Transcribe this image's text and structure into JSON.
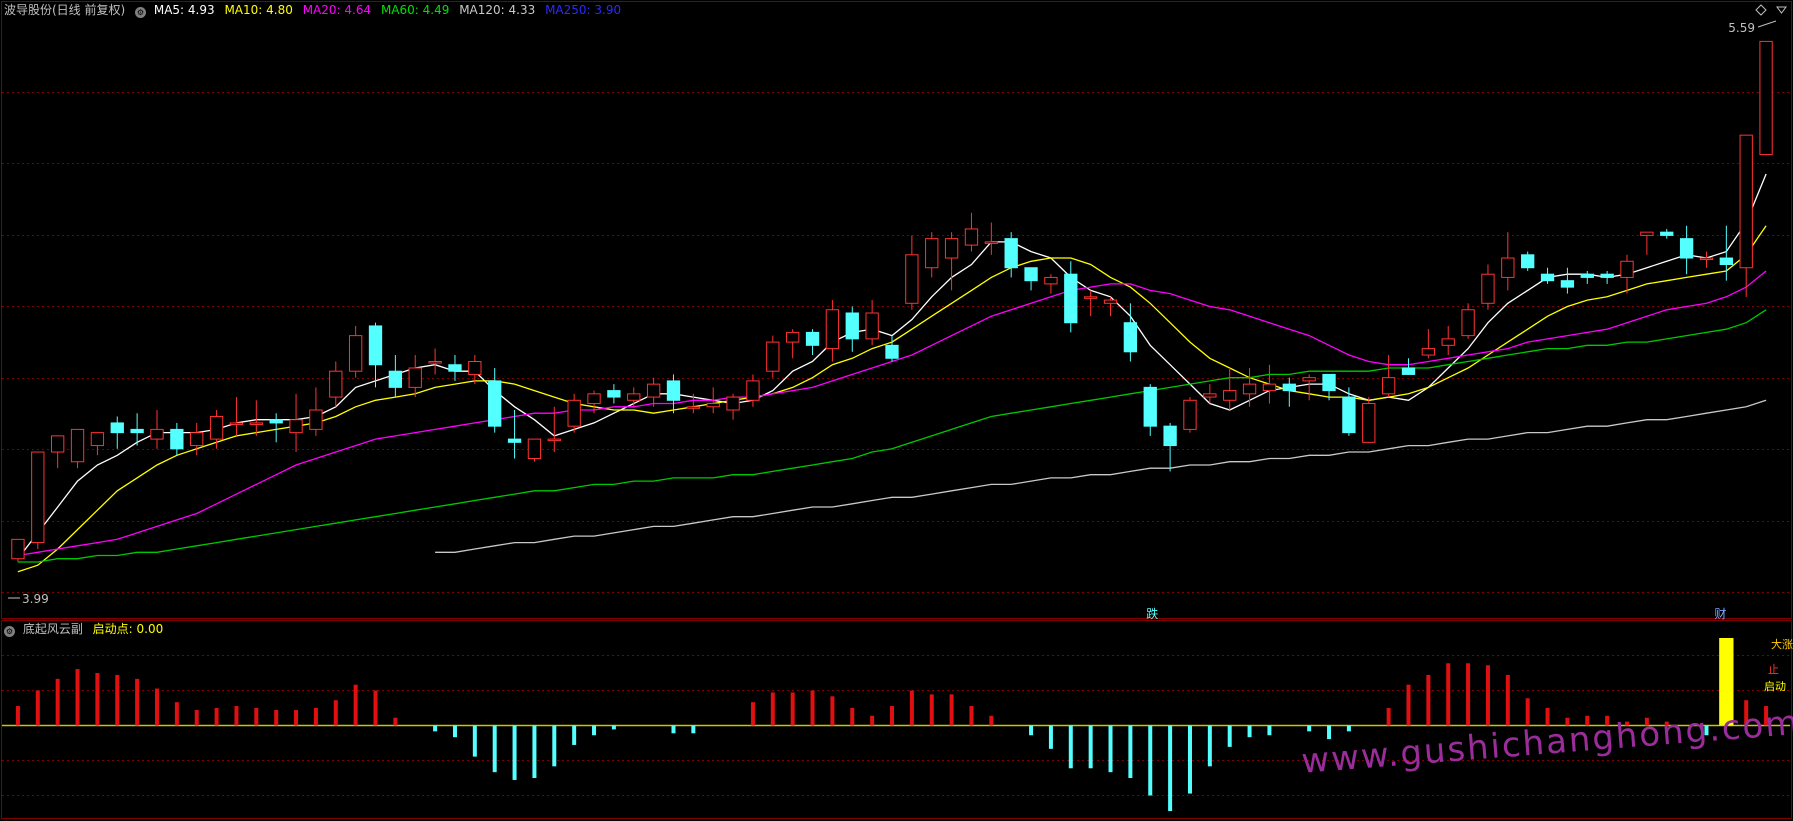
{
  "colors": {
    "background": "#000000",
    "up": "#ff3232",
    "down": "#54ffff",
    "ma5": "#ffffff",
    "ma10": "#ffff00",
    "ma20": "#ff00ff",
    "ma60": "#00c800",
    "ma120": "#c8c8c8",
    "ma250": "#0000ff",
    "grid": "#800000",
    "zero": "#c8c800",
    "highlight": "#ffff00"
  },
  "main_header": {
    "stock": "波导股份(日线 前复权)",
    "ma5": "MA5: 4.93",
    "ma10": "MA10: 4.80",
    "ma20": "MA20: 4.64",
    "ma60": "MA60: 4.49",
    "ma120": "MA120: 4.33",
    "ma250": "MA250: 3.90"
  },
  "sub_header": {
    "name": "底起风云副",
    "qidong": "启动点: 0.00"
  },
  "labels": {
    "high": "5.59",
    "low": "3.99",
    "die": "跌",
    "cai": "财",
    "qidong": "启动",
    "zhi": "止",
    "top": "大涨"
  },
  "watermark": "www.gushichanghong.com",
  "chart_data": [
    {
      "type": "candlestick",
      "y_range": [
        3.85,
        5.65
      ],
      "ohlc": [
        [
          3.99,
          4.05,
          3.98,
          4.04
        ],
        [
          4.04,
          4.32,
          4.02,
          4.3
        ],
        [
          4.32,
          4.37,
          4.27,
          4.33
        ],
        [
          4.29,
          4.39,
          4.27,
          4.36
        ],
        [
          4.34,
          4.38,
          4.31,
          4.36
        ],
        [
          4.41,
          4.38,
          4.33,
          4.43
        ],
        [
          4.39,
          4.38,
          4.34,
          4.44
        ],
        [
          4.36,
          4.39,
          4.33,
          4.45
        ],
        [
          4.39,
          4.33,
          4.31,
          4.41
        ],
        [
          4.34,
          4.38,
          4.31,
          4.41
        ],
        [
          4.36,
          4.43,
          4.33,
          4.45
        ],
        [
          4.41,
          4.41,
          4.37,
          4.49
        ],
        [
          4.41,
          4.41,
          4.37,
          4.48
        ],
        [
          4.42,
          4.41,
          4.35,
          4.44
        ],
        [
          4.38,
          4.42,
          4.32,
          4.5
        ],
        [
          4.39,
          4.45,
          4.37,
          4.52
        ],
        [
          4.49,
          4.57,
          4.46,
          4.6
        ],
        [
          4.57,
          4.68,
          4.55,
          4.71
        ],
        [
          4.71,
          4.59,
          4.52,
          4.72
        ],
        [
          4.57,
          4.52,
          4.49,
          4.62
        ],
        [
          4.52,
          4.58,
          4.49,
          4.62
        ],
        [
          4.6,
          4.6,
          4.56,
          4.64
        ],
        [
          4.59,
          4.57,
          4.54,
          4.62
        ],
        [
          4.56,
          4.6,
          4.53,
          4.62
        ],
        [
          4.54,
          4.4,
          4.38,
          4.58
        ],
        [
          4.36,
          4.35,
          4.3,
          4.45
        ],
        [
          4.3,
          4.36,
          4.29,
          4.36
        ],
        [
          4.36,
          4.36,
          4.32,
          4.46
        ],
        [
          4.4,
          4.48,
          4.38,
          4.5
        ],
        [
          4.47,
          4.5,
          4.44,
          4.51
        ],
        [
          4.51,
          4.49,
          4.47,
          4.53
        ],
        [
          4.48,
          4.5,
          4.46,
          4.52
        ],
        [
          4.49,
          4.53,
          4.46,
          4.55
        ],
        [
          4.54,
          4.48,
          4.44,
          4.56
        ],
        [
          4.46,
          4.46,
          4.44,
          4.5
        ],
        [
          4.46,
          4.47,
          4.44,
          4.52
        ],
        [
          4.45,
          4.49,
          4.42,
          4.5
        ],
        [
          4.48,
          4.54,
          4.46,
          4.56
        ],
        [
          4.57,
          4.66,
          4.55,
          4.68
        ],
        [
          4.66,
          4.69,
          4.61,
          4.7
        ],
        [
          4.69,
          4.65,
          4.62,
          4.7
        ],
        [
          4.64,
          4.76,
          4.6,
          4.79
        ],
        [
          4.75,
          4.67,
          4.63,
          4.77
        ],
        [
          4.67,
          4.75,
          4.65,
          4.79
        ],
        [
          4.65,
          4.61,
          4.6,
          4.68
        ],
        [
          4.78,
          4.93,
          4.76,
          4.99
        ],
        [
          4.89,
          4.98,
          4.86,
          5.0
        ],
        [
          4.92,
          4.98,
          4.82,
          5.0
        ],
        [
          4.96,
          5.01,
          4.94,
          5.06
        ],
        [
          4.97,
          4.97,
          4.93,
          5.03
        ],
        [
          4.98,
          4.89,
          4.86,
          5.0
        ],
        [
          4.89,
          4.85,
          4.82,
          4.87
        ],
        [
          4.84,
          4.86,
          4.81,
          4.87
        ],
        [
          4.87,
          4.72,
          4.69,
          4.91
        ],
        [
          4.8,
          4.8,
          4.74,
          4.82
        ],
        [
          4.78,
          4.79,
          4.74,
          4.8
        ],
        [
          4.72,
          4.63,
          4.6,
          4.78
        ],
        [
          4.52,
          4.4,
          4.37,
          4.53
        ],
        [
          4.4,
          4.34,
          4.26,
          4.41
        ],
        [
          4.39,
          4.48,
          4.38,
          4.49
        ],
        [
          4.49,
          4.5,
          4.47,
          4.53
        ],
        [
          4.48,
          4.51,
          4.45,
          4.58
        ],
        [
          4.5,
          4.53,
          4.46,
          4.58
        ],
        [
          4.51,
          4.53,
          4.47,
          4.59
        ],
        [
          4.53,
          4.51,
          4.46,
          4.55
        ],
        [
          4.54,
          4.55,
          4.48,
          4.56
        ],
        [
          4.56,
          4.51,
          4.48,
          4.56
        ],
        [
          4.49,
          4.38,
          4.37,
          4.52
        ],
        [
          4.35,
          4.47,
          4.35,
          4.49
        ],
        [
          4.5,
          4.55,
          4.49,
          4.62
        ],
        [
          4.58,
          4.56,
          4.56,
          4.61
        ],
        [
          4.62,
          4.64,
          4.61,
          4.7
        ],
        [
          4.65,
          4.67,
          4.62,
          4.71
        ],
        [
          4.68,
          4.76,
          4.67,
          4.78
        ],
        [
          4.78,
          4.87,
          4.76,
          4.9
        ],
        [
          4.86,
          4.92,
          4.82,
          5.0
        ],
        [
          4.93,
          4.89,
          4.88,
          4.94
        ],
        [
          4.87,
          4.85,
          4.84,
          4.89
        ],
        [
          4.85,
          4.83,
          4.81,
          4.89
        ],
        [
          4.87,
          4.86,
          4.84,
          4.88
        ],
        [
          4.87,
          4.86,
          4.84,
          4.88
        ],
        [
          4.86,
          4.91,
          4.81,
          4.93
        ],
        [
          4.99,
          5.0,
          4.93,
          5.0
        ],
        [
          5.0,
          4.99,
          4.98,
          5.01
        ],
        [
          4.98,
          4.92,
          4.87,
          5.02
        ],
        [
          4.92,
          4.92,
          4.89,
          4.94
        ],
        [
          4.92,
          4.9,
          4.85,
          5.02
        ],
        [
          4.89,
          5.3,
          4.8,
          5.3
        ],
        [
          5.24,
          5.59,
          5.25,
          5.59
        ]
      ]
    },
    {
      "type": "line",
      "series": [
        {
          "key": "ma5",
          "values": [
            3.99,
            4.07,
            4.15,
            4.23,
            4.28,
            4.31,
            4.35,
            4.38,
            4.38,
            4.38,
            4.39,
            4.41,
            4.42,
            4.42,
            4.42,
            4.43,
            4.46,
            4.52,
            4.54,
            4.56,
            4.58,
            4.59,
            4.57,
            4.57,
            4.51,
            4.46,
            4.42,
            4.37,
            4.39,
            4.41,
            4.44,
            4.47,
            4.5,
            4.5,
            4.49,
            4.48,
            4.47,
            4.48,
            4.51,
            4.57,
            4.6,
            4.66,
            4.69,
            4.7,
            4.68,
            4.73,
            4.8,
            4.86,
            4.9,
            4.97,
            4.97,
            4.94,
            4.92,
            4.86,
            4.82,
            4.8,
            4.74,
            4.65,
            4.59,
            4.53,
            4.47,
            4.45,
            4.48,
            4.51,
            4.52,
            4.53,
            4.53,
            4.5,
            4.48,
            4.49,
            4.48,
            4.52,
            4.58,
            4.64,
            4.72,
            4.78,
            4.82,
            4.86,
            4.87,
            4.87,
            4.86,
            4.87,
            4.89,
            4.91,
            4.93,
            4.92,
            4.94,
            5.03,
            5.18
          ]
        },
        {
          "key": "ma10",
          "values": [
            3.95,
            3.97,
            4.02,
            4.08,
            4.14,
            4.2,
            4.24,
            4.28,
            4.31,
            4.33,
            4.35,
            4.37,
            4.38,
            4.39,
            4.4,
            4.41,
            4.43,
            4.46,
            4.48,
            4.49,
            4.5,
            4.52,
            4.53,
            4.54,
            4.54,
            4.53,
            4.51,
            4.49,
            4.47,
            4.46,
            4.45,
            4.45,
            4.44,
            4.45,
            4.46,
            4.47,
            4.48,
            4.49,
            4.5,
            4.52,
            4.55,
            4.59,
            4.61,
            4.64,
            4.66,
            4.7,
            4.74,
            4.78,
            4.82,
            4.86,
            4.89,
            4.91,
            4.92,
            4.92,
            4.9,
            4.86,
            4.83,
            4.78,
            4.72,
            4.66,
            4.61,
            4.58,
            4.55,
            4.53,
            4.51,
            4.5,
            4.49,
            4.49,
            4.48,
            4.49,
            4.5,
            4.52,
            4.55,
            4.58,
            4.62,
            4.66,
            4.7,
            4.74,
            4.77,
            4.79,
            4.8,
            4.82,
            4.84,
            4.85,
            4.86,
            4.87,
            4.88,
            4.93,
            5.02
          ]
        },
        {
          "key": "ma20",
          "values": [
            4.0,
            4.01,
            4.02,
            4.03,
            4.04,
            4.05,
            4.07,
            4.09,
            4.11,
            4.13,
            4.16,
            4.19,
            4.22,
            4.25,
            4.28,
            4.3,
            4.32,
            4.34,
            4.36,
            4.37,
            4.38,
            4.39,
            4.4,
            4.41,
            4.42,
            4.43,
            4.44,
            4.44,
            4.45,
            4.45,
            4.46,
            4.46,
            4.47,
            4.47,
            4.48,
            4.48,
            4.49,
            4.49,
            4.5,
            4.51,
            4.52,
            4.54,
            4.56,
            4.58,
            4.6,
            4.62,
            4.65,
            4.68,
            4.71,
            4.74,
            4.76,
            4.78,
            4.8,
            4.82,
            4.83,
            4.84,
            4.84,
            4.82,
            4.81,
            4.79,
            4.77,
            4.76,
            4.74,
            4.72,
            4.7,
            4.68,
            4.65,
            4.62,
            4.6,
            4.59,
            4.59,
            4.6,
            4.61,
            4.62,
            4.63,
            4.64,
            4.66,
            4.67,
            4.68,
            4.69,
            4.7,
            4.72,
            4.74,
            4.76,
            4.77,
            4.78,
            4.8,
            4.83,
            4.88
          ]
        },
        {
          "key": "ma60",
          "values": [
            3.98,
            3.98,
            3.99,
            3.99,
            4.0,
            4.0,
            4.01,
            4.01,
            4.02,
            4.03,
            4.04,
            4.05,
            4.06,
            4.07,
            4.08,
            4.09,
            4.1,
            4.11,
            4.12,
            4.13,
            4.14,
            4.15,
            4.16,
            4.17,
            4.18,
            4.19,
            4.2,
            4.2,
            4.21,
            4.22,
            4.22,
            4.23,
            4.23,
            4.24,
            4.24,
            4.24,
            4.25,
            4.25,
            4.26,
            4.27,
            4.28,
            4.29,
            4.3,
            4.32,
            4.33,
            4.35,
            4.37,
            4.39,
            4.41,
            4.43,
            4.44,
            4.45,
            4.46,
            4.47,
            4.48,
            4.49,
            4.5,
            4.51,
            4.52,
            4.53,
            4.54,
            4.55,
            4.55,
            4.56,
            4.56,
            4.57,
            4.57,
            4.57,
            4.57,
            4.58,
            4.58,
            4.58,
            4.59,
            4.6,
            4.61,
            4.62,
            4.63,
            4.64,
            4.64,
            4.65,
            4.65,
            4.66,
            4.66,
            4.67,
            4.68,
            4.69,
            4.7,
            4.72,
            4.76
          ]
        },
        {
          "key": "ma120",
          "values": [
            null,
            null,
            null,
            null,
            null,
            null,
            null,
            null,
            null,
            null,
            null,
            null,
            null,
            null,
            null,
            null,
            null,
            null,
            null,
            null,
            null,
            4.01,
            4.01,
            4.02,
            4.03,
            4.04,
            4.04,
            4.05,
            4.06,
            4.06,
            4.07,
            4.08,
            4.09,
            4.09,
            4.1,
            4.11,
            4.12,
            4.12,
            4.13,
            4.14,
            4.15,
            4.15,
            4.16,
            4.17,
            4.18,
            4.18,
            4.19,
            4.2,
            4.21,
            4.22,
            4.22,
            4.23,
            4.24,
            4.24,
            4.25,
            4.25,
            4.26,
            4.27,
            4.27,
            4.28,
            4.28,
            4.29,
            4.29,
            4.3,
            4.3,
            4.31,
            4.31,
            4.32,
            4.32,
            4.33,
            4.34,
            4.34,
            4.35,
            4.36,
            4.36,
            4.37,
            4.38,
            4.38,
            4.39,
            4.4,
            4.4,
            4.41,
            4.42,
            4.42,
            4.43,
            4.44,
            4.45,
            4.46,
            4.48
          ]
        }
      ]
    },
    {
      "type": "bar",
      "y_range": [
        -0.45,
        0.45
      ],
      "values": [
        0.1,
        0.18,
        0.24,
        0.29,
        0.27,
        0.26,
        0.24,
        0.19,
        0.12,
        0.08,
        0.09,
        0.1,
        0.09,
        0.08,
        0.08,
        0.09,
        0.13,
        0.21,
        0.18,
        0.04,
        0,
        -0.03,
        -0.06,
        -0.16,
        -0.24,
        -0.28,
        -0.27,
        -0.21,
        -0.1,
        -0.05,
        -0.02,
        0,
        0,
        -0.04,
        -0.04,
        0,
        0,
        0.12,
        0.17,
        0.17,
        0.18,
        0.15,
        0.09,
        0.05,
        0.1,
        0.18,
        0.16,
        0.16,
        0.1,
        0.05,
        0,
        -0.05,
        -0.12,
        -0.22,
        -0.22,
        -0.24,
        -0.27,
        -0.36,
        -0.44,
        -0.35,
        -0.21,
        -0.11,
        -0.06,
        -0.05,
        0,
        -0.03,
        -0.07,
        -0.03,
        0,
        0.09,
        0.21,
        0.26,
        0.32,
        0.32,
        0.31,
        0.26,
        0.14,
        0.09,
        0.04,
        0.05,
        0.05,
        0.02,
        0.04,
        0.02,
        0,
        -0.05,
        0.45,
        0.13,
        0.1
      ]
    }
  ]
}
